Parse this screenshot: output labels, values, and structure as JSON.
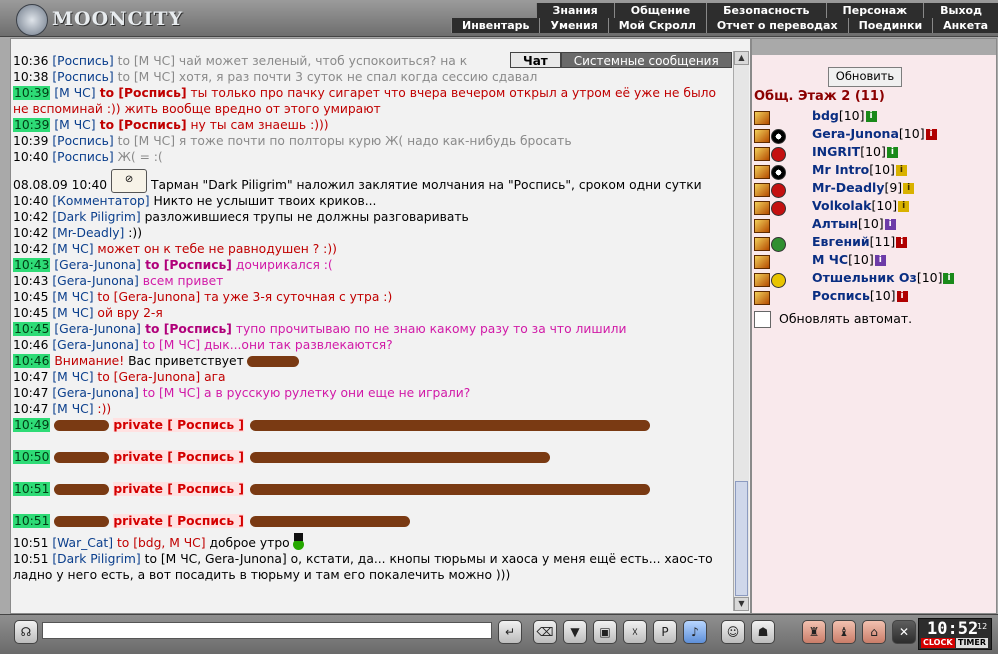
{
  "app": {
    "title": "MOONCITY"
  },
  "menu": {
    "row1": [
      "Знания",
      "Общение",
      "Безопасность",
      "Персонаж",
      "Выход"
    ],
    "row2": [
      "Инвентарь",
      "Умения",
      "Мой Скролл",
      "Отчет о переводах",
      "Поединки",
      "Анкета"
    ]
  },
  "tabs": {
    "chat": "Чат",
    "system": "Системные сообщения"
  },
  "chat": {
    "lines": [
      {
        "time": "10:36",
        "hl": false,
        "nick": "[Роспись]",
        "to": " to [М ЧС]",
        "text": " чай может зеленый, чтоб успокоиться? на к",
        "style": "grey"
      },
      {
        "time": "10:38",
        "hl": false,
        "nick": "[Роспись]",
        "to": " to [М ЧС]",
        "text": " хотя, я раз почти 3 суток не спал когда сессию сдавал",
        "style": "grey"
      },
      {
        "time": "10:39",
        "hl": true,
        "nick": "[М ЧС]",
        "to": " to [Роспись]",
        "text": " ты только про пачку сигарет что вчера вечером открыл а утром её уже не было не вспоминай :)) жить вообще вредно от этого умирают",
        "style": "red-bold"
      },
      {
        "time": "10:39",
        "hl": true,
        "nick": "[М ЧС]",
        "to": " to [Роспись]",
        "text": " ну ты сам знаешь :)))",
        "style": "red-bold"
      },
      {
        "time": "10:39",
        "hl": false,
        "nick": "[Роспись]",
        "to": " to [М ЧС]",
        "text": " я тоже почти по полторы курю Ж( надо как-нибудь бросать",
        "style": "grey"
      },
      {
        "time": "10:40",
        "hl": false,
        "nick": "[Роспись]",
        "to": "",
        "text": " Ж( = :(",
        "style": "grey"
      },
      {
        "time": "08.08.09 10:40",
        "hl": false,
        "nick": "",
        "to": "",
        "text": " Тарман \"Dark Piligrim\" наложил заклятие молчания на \"Роспись\", сроком одни сутки",
        "style": "system"
      },
      {
        "time": "10:40",
        "hl": false,
        "nick": "[Комментатор]",
        "to": "",
        "text": " Никто не услышит твоих криков...",
        "style": "plain"
      },
      {
        "time": "10:42",
        "hl": false,
        "nick": "[Dark Piligrim]",
        "to": "",
        "text": " разложившиеся трупы не должны разговаривать",
        "style": "plain"
      },
      {
        "time": "10:42",
        "hl": false,
        "nick": "[Mr-Deadly]",
        "to": "",
        "text": " :))",
        "style": "plain"
      },
      {
        "time": "10:42",
        "hl": false,
        "nick": "[М ЧС]",
        "to": "",
        "text": " может он к тебе не равнодушен ? :))",
        "style": "red"
      },
      {
        "time": "10:43",
        "hl": true,
        "nick": "[Gera-Junona]",
        "to": " to [Роспись]",
        "text": " дочирикался :(",
        "style": "pink-bold"
      },
      {
        "time": "10:43",
        "hl": false,
        "nick": "[Gera-Junona]",
        "to": "",
        "text": " всем привет",
        "style": "pink"
      },
      {
        "time": "10:45",
        "hl": false,
        "nick": "[М ЧС]",
        "to": " to [Gera-Junona]",
        "text": " та уже 3-я суточная с утра :)",
        "style": "red"
      },
      {
        "time": "10:45",
        "hl": false,
        "nick": "[М ЧС]",
        "to": "",
        "text": " ой вру 2-я",
        "style": "red"
      },
      {
        "time": "10:45",
        "hl": true,
        "nick": "[Gera-Junona]",
        "to": " to [Роспись]",
        "text": " тупо прочитываю по не знаю какому разу то за что лишили",
        "style": "pink-bold"
      },
      {
        "time": "10:46",
        "hl": false,
        "nick": "[Gera-Junona]",
        "to": " to [М ЧС]",
        "text": " дык...они так развлекаются?",
        "style": "pink"
      },
      {
        "time": "10:46",
        "hl": true,
        "nick": "Внимание!",
        "to": "",
        "text": " Вас приветствует",
        "style": "attention"
      },
      {
        "time": "10:47",
        "hl": false,
        "nick": "[М ЧС]",
        "to": " to [Gera-Junona]",
        "text": " ага",
        "style": "red"
      },
      {
        "time": "10:47",
        "hl": false,
        "nick": "[Gera-Junona]",
        "to": " to [М ЧС]",
        "text": " а в русскую рулетку они еще не играли?",
        "style": "pink"
      },
      {
        "time": "10:47",
        "hl": false,
        "nick": "[М ЧС]",
        "to": "",
        "text": " :))",
        "style": "red"
      },
      {
        "time": "10:49",
        "hl": true,
        "nick": "",
        "to": "",
        "text": "private [ Роспись ]",
        "style": "private"
      },
      {
        "time": "10:50",
        "hl": true,
        "nick": "",
        "to": "",
        "text": "private [ Роспись ]",
        "style": "private"
      },
      {
        "time": "10:51",
        "hl": true,
        "nick": "",
        "to": "",
        "text": "private [ Роспись ]",
        "style": "private"
      },
      {
        "time": "10:51",
        "hl": true,
        "nick": "",
        "to": "",
        "text": "private [ Роспись ]",
        "style": "private"
      },
      {
        "time": "10:51",
        "hl": false,
        "nick": "[War_Cat]",
        "to": " to [bdg, М ЧС]",
        "text": " доброе утро",
        "style": "plain"
      },
      {
        "time": "10:51",
        "hl": false,
        "nick": "[Dark Piligrim]",
        "to": "",
        "text": " to [М ЧС, Gera-Junona] о, кстати, да... кнопы тюрьмы и хаоса у меня ещё есть... хаос-то ладно у него есть, а вот посадить в тюрьму и там его покалечить можно )))",
        "style": "plain"
      }
    ]
  },
  "side": {
    "refresh_label": "Обновить",
    "room_title": "Общ. Этаж 2 (11)",
    "users": [
      {
        "name": "bdg",
        "level": "[10]",
        "info": "green",
        "sub": "none"
      },
      {
        "name": "Gera-Junona",
        "level": "[10]",
        "info": "red",
        "sub": "yin"
      },
      {
        "name": "INGRIT",
        "level": "[10]",
        "info": "green",
        "sub": "red"
      },
      {
        "name": "Mr Intro",
        "level": "[10]",
        "info": "yellow",
        "sub": "yin"
      },
      {
        "name": "Mr-Deadly",
        "level": "[9]",
        "info": "yellow",
        "sub": "red"
      },
      {
        "name": "Volkolak",
        "level": "[10]",
        "info": "yellow",
        "sub": "red"
      },
      {
        "name": "Алтын",
        "level": "[10]",
        "info": "purple",
        "sub": "none"
      },
      {
        "name": "Евгений",
        "level": "[11]",
        "info": "red",
        "sub": "green"
      },
      {
        "name": "М ЧС",
        "level": "[10]",
        "info": "purple",
        "sub": "none"
      },
      {
        "name": "Отшельник Оз",
        "level": "[10]",
        "info": "green",
        "sub": "yellow"
      },
      {
        "name": "Роспись",
        "level": "[10]",
        "info": "red",
        "sub": "none"
      }
    ],
    "auto_refresh_label": "Обновлять автомат."
  },
  "bottombar": {
    "message_value": "",
    "clock_time": "10:52",
    "clock_seconds": "12",
    "clock_label": "CLOCK",
    "timer_label": "TIMER"
  },
  "colors": {
    "highlight": "#2edb76",
    "private": "#d40000",
    "room_title": "#8b0000"
  }
}
